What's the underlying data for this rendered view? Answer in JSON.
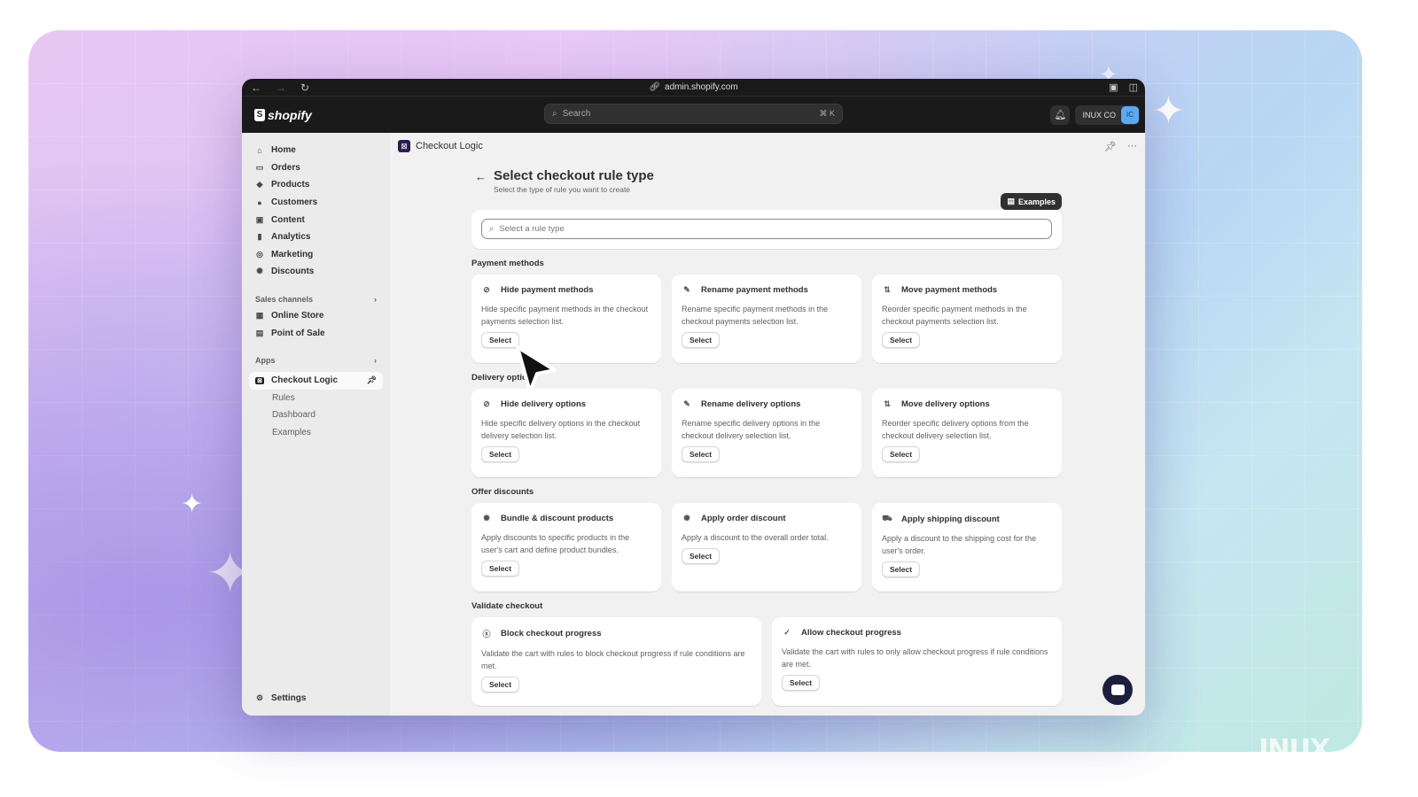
{
  "browser": {
    "url": "admin.shopify.com"
  },
  "topbar": {
    "brand": "shopify",
    "search_placeholder": "Search",
    "search_shortcut": "⌘ K",
    "store_name": "INUX CO",
    "avatar_initials": "IC"
  },
  "sidebar": {
    "items": [
      {
        "label": "Home",
        "icon": "home-icon"
      },
      {
        "label": "Orders",
        "icon": "inbox-icon"
      },
      {
        "label": "Products",
        "icon": "tag-icon"
      },
      {
        "label": "Customers",
        "icon": "person-icon"
      },
      {
        "label": "Content",
        "icon": "image-icon"
      },
      {
        "label": "Analytics",
        "icon": "bar-chart-icon"
      },
      {
        "label": "Marketing",
        "icon": "target-icon"
      },
      {
        "label": "Discounts",
        "icon": "discount-icon"
      }
    ],
    "sales_channels_label": "Sales channels",
    "channels": [
      {
        "label": "Online Store"
      },
      {
        "label": "Point of Sale"
      }
    ],
    "apps_label": "Apps",
    "app": {
      "label": "Checkout Logic",
      "subitems": [
        "Rules",
        "Dashboard",
        "Examples"
      ]
    },
    "settings_label": "Settings"
  },
  "app_header": {
    "title": "Checkout Logic"
  },
  "page": {
    "title": "Select checkout rule type",
    "subtitle": "Select the type of rule you want to create",
    "examples_label": "Examples",
    "search_placeholder": "Select a rule type"
  },
  "sections": [
    {
      "title": "Payment methods",
      "cards": [
        {
          "title": "Hide payment methods",
          "desc": "Hide specific payment methods in the checkout payments selection list.",
          "button": "Select"
        },
        {
          "title": "Rename payment methods",
          "desc": "Rename specific payment methods in the checkout payments selection list.",
          "button": "Select"
        },
        {
          "title": "Move payment methods",
          "desc": "Reorder specific payment methods in the checkout payments selection list.",
          "button": "Select"
        }
      ]
    },
    {
      "title": "Delivery options",
      "cards": [
        {
          "title": "Hide delivery options",
          "desc": "Hide specific delivery options in the checkout delivery selection list.",
          "button": "Select"
        },
        {
          "title": "Rename delivery options",
          "desc": "Rename specific delivery options in the checkout delivery selection list.",
          "button": "Select"
        },
        {
          "title": "Move delivery options",
          "desc": "Reorder specific delivery options from the checkout delivery selection list.",
          "button": "Select"
        }
      ]
    },
    {
      "title": "Offer discounts",
      "cards": [
        {
          "title": "Bundle & discount products",
          "desc": "Apply discounts to specific products in the user's cart and define product bundles.",
          "button": "Select"
        },
        {
          "title": "Apply order discount",
          "desc": "Apply a discount to the overall order total.",
          "button": "Select"
        },
        {
          "title": "Apply shipping discount",
          "desc": "Apply a discount to the shipping cost for the user's order.",
          "button": "Select"
        }
      ]
    },
    {
      "title": "Validate checkout",
      "cards": [
        {
          "title": "Block checkout progress",
          "desc": "Validate the cart with rules to block checkout progress if rule conditions are met.",
          "button": "Select"
        },
        {
          "title": "Allow checkout progress",
          "desc": "Validate the cart with rules to only allow checkout progress if rule conditions are met.",
          "button": "Select"
        }
      ]
    }
  ],
  "watermark": "INUX"
}
